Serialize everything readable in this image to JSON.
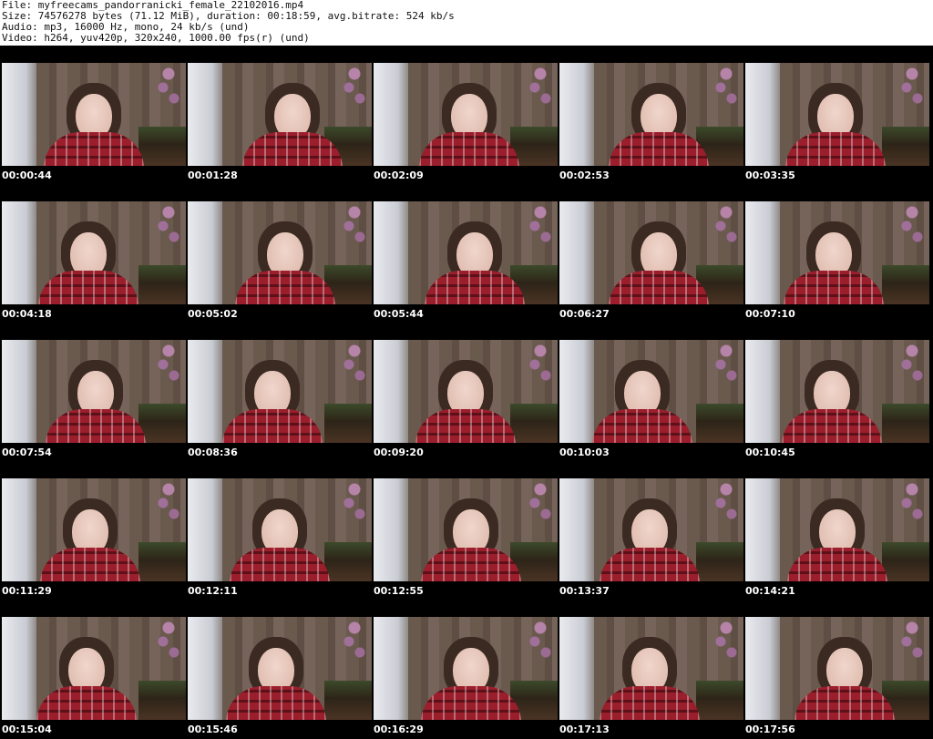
{
  "info": {
    "file": "File: myfreecams_pandorranicki_female_22102016.mp4",
    "size": "Size: 74576278 bytes (71.12 MiB), duration: 00:18:59, avg.bitrate: 524 kb/s",
    "audio": "Audio: mp3, 16000 Hz, mono, 24 kb/s (und)",
    "video": "Video: h264, yuv420p, 320x240, 1000.00 fps(r) (und)"
  },
  "thumbnails": [
    {
      "time": "00:00:44"
    },
    {
      "time": "00:01:28"
    },
    {
      "time": "00:02:09"
    },
    {
      "time": "00:02:53"
    },
    {
      "time": "00:03:35"
    },
    {
      "time": "00:04:18"
    },
    {
      "time": "00:05:02"
    },
    {
      "time": "00:05:44"
    },
    {
      "time": "00:06:27"
    },
    {
      "time": "00:07:10"
    },
    {
      "time": "00:07:54"
    },
    {
      "time": "00:08:36"
    },
    {
      "time": "00:09:20"
    },
    {
      "time": "00:10:03"
    },
    {
      "time": "00:10:45"
    },
    {
      "time": "00:11:29"
    },
    {
      "time": "00:12:11"
    },
    {
      "time": "00:12:55"
    },
    {
      "time": "00:13:37"
    },
    {
      "time": "00:14:21"
    },
    {
      "time": "00:15:04"
    },
    {
      "time": "00:15:46"
    },
    {
      "time": "00:16:29"
    },
    {
      "time": "00:17:13"
    },
    {
      "time": "00:17:56"
    }
  ]
}
